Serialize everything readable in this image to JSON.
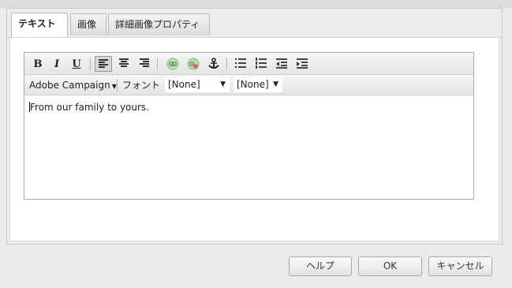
{
  "tabs": [
    {
      "label": "テキスト",
      "active": true
    },
    {
      "label": "画像",
      "active": false
    },
    {
      "label": "詳細画像プロパティ",
      "active": false
    }
  ],
  "toolbar": {
    "bold": "B",
    "italic": "I",
    "underline": "U",
    "icons": [
      "bold-icon",
      "italic-icon",
      "underline-icon",
      "align-left-icon",
      "align-center-icon",
      "align-right-icon",
      "link-icon",
      "unlink-icon",
      "anchor-icon",
      "bulleted-list-icon",
      "numbered-list-icon",
      "outdent-icon",
      "indent-icon"
    ]
  },
  "toolbar2": {
    "campaign_menu": "Adobe Campaign",
    "font_label": "フォント",
    "font_select": "[None]",
    "size_select": "[None]"
  },
  "editor": {
    "content": "From our family to yours."
  },
  "footer": {
    "help": "ヘルプ",
    "ok": "OK",
    "cancel": "キャンセル"
  },
  "colors": {
    "link_icon": "#8fc98a",
    "unlink_icon": "#c98a8a"
  }
}
